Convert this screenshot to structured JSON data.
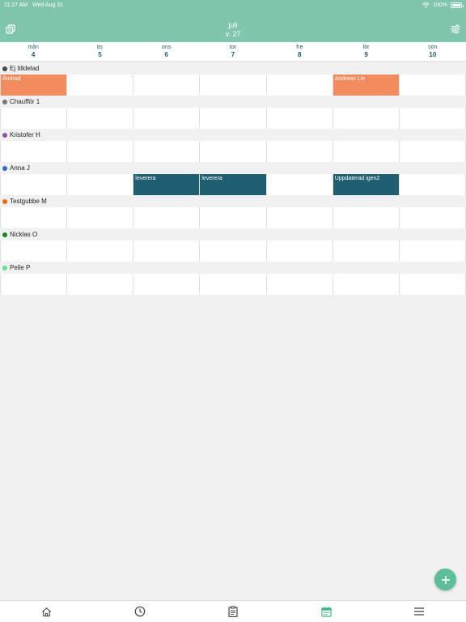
{
  "status": {
    "time": "11:27 AM",
    "date": "Wed Aug 31",
    "battery": "100%"
  },
  "header": {
    "month": "juli",
    "week": "v. 27"
  },
  "days": [
    {
      "name": "mån",
      "date": "4"
    },
    {
      "name": "tis",
      "date": "5"
    },
    {
      "name": "ons",
      "date": "6"
    },
    {
      "name": "tor",
      "date": "7"
    },
    {
      "name": "fre",
      "date": "8"
    },
    {
      "name": "lör",
      "date": "9"
    },
    {
      "name": "sön",
      "date": "10"
    }
  ],
  "people": [
    {
      "name": "Ej tilldelad",
      "color": "#444444"
    },
    {
      "name": "Chaufför 1",
      "color": "#777777"
    },
    {
      "name": "Kristofer H",
      "color": "#8a5a9e"
    },
    {
      "name": "Anna J",
      "color": "#3366cc"
    },
    {
      "name": "Testgubbe M",
      "color": "#ff6600"
    },
    {
      "name": "Nicklas O",
      "color": "#138a13"
    },
    {
      "name": "Pelle P",
      "color": "#66dd88"
    }
  ],
  "events": {
    "ej_mon": "Ändrad",
    "ej_sat": "Andreas Lie",
    "anna_wed": "leverera",
    "anna_thu": "leverera",
    "anna_sat": "Uppdaterad igen2"
  },
  "colors": {
    "header": "#7fc6ad",
    "orange_event": "#f28c5f",
    "teal_event": "#1f5e6e",
    "fab": "#5bbf97"
  },
  "tabs": [
    "home-icon",
    "clock-icon",
    "clipboard-icon",
    "calendar-icon",
    "menu-icon"
  ]
}
